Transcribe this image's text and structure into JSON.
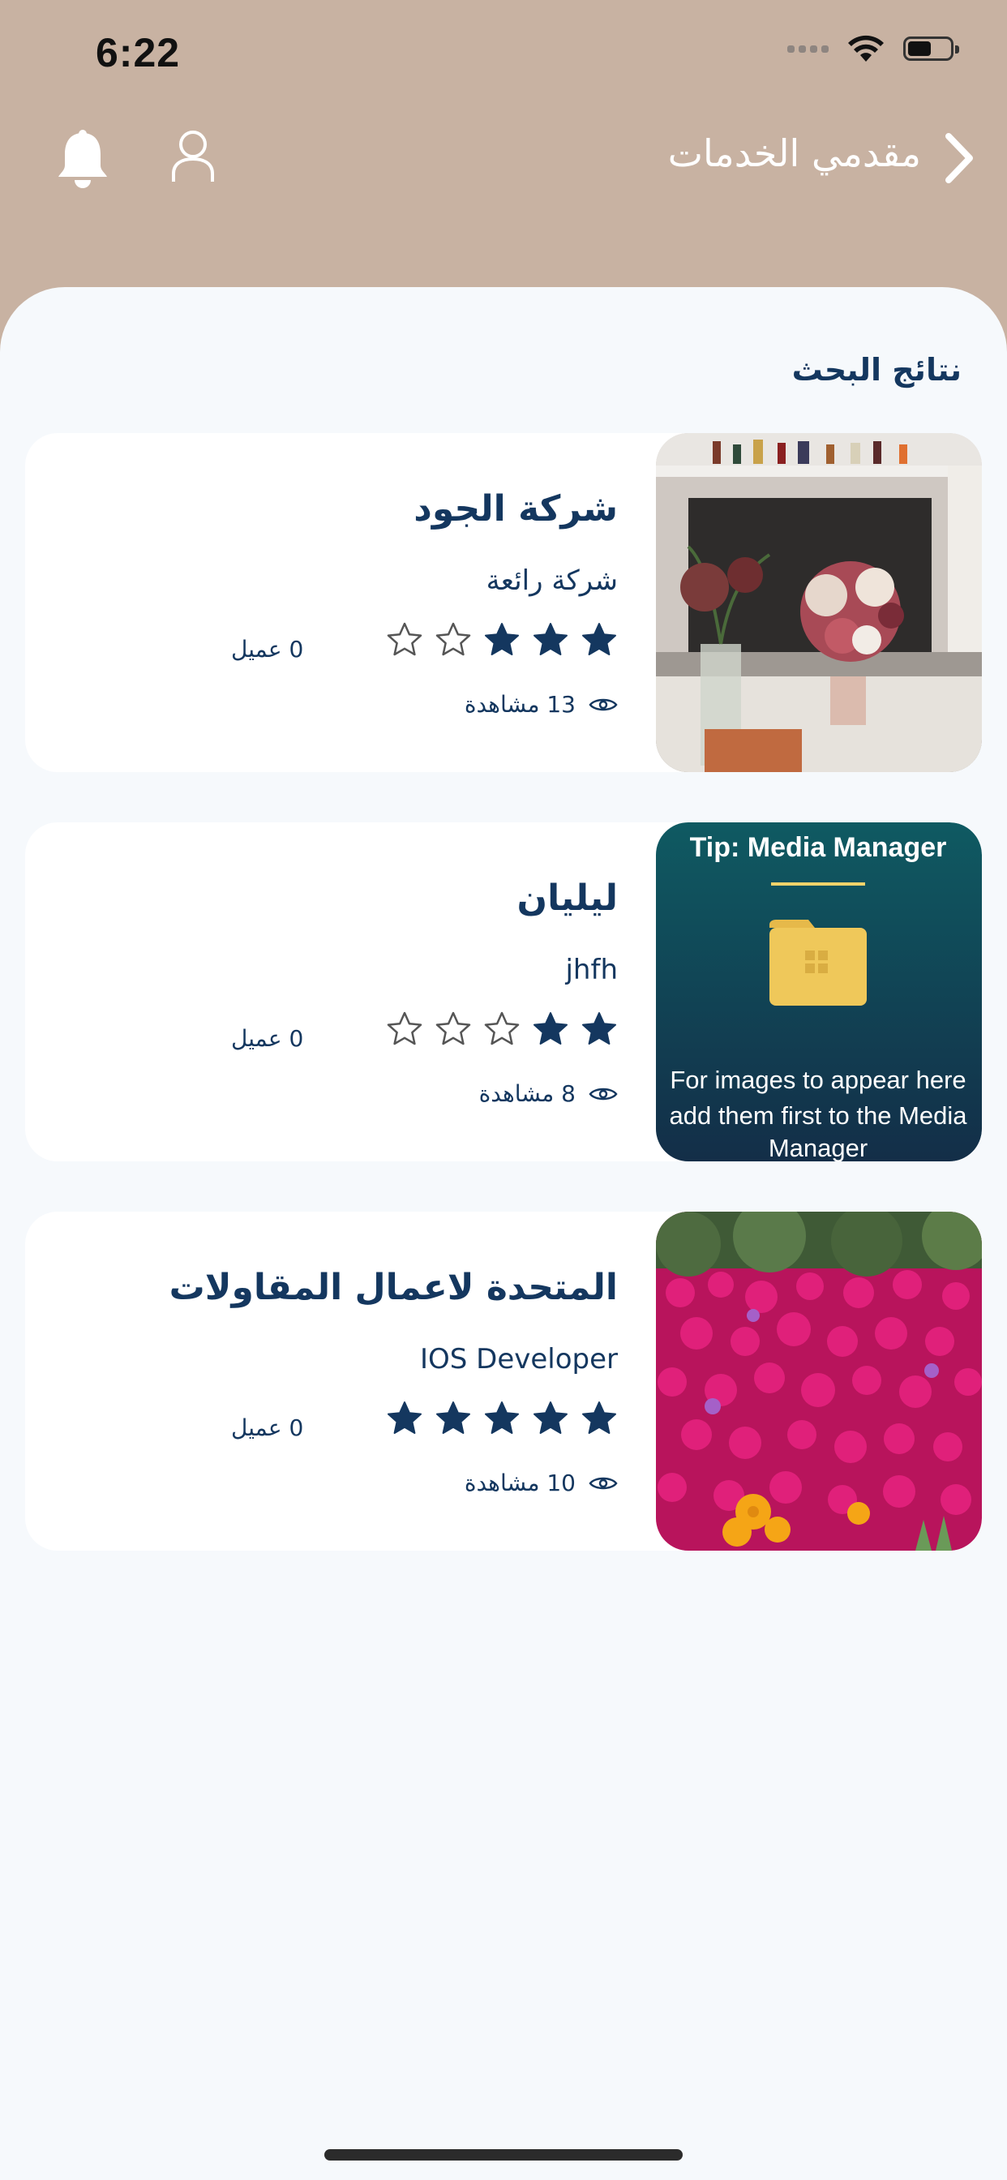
{
  "status": {
    "time": "6:22"
  },
  "header": {
    "title": "مقدمي الخدمات"
  },
  "section_title": "نتائج البحث",
  "results": [
    {
      "name": "شركة الجود",
      "subtitle": "شركة رائعة",
      "rating": 3,
      "clients": "0 عميل",
      "views": "13 مشاهدة"
    },
    {
      "name": "ليليان",
      "subtitle": "jhfh",
      "rating": 2,
      "clients": "0 عميل",
      "views": "8 مشاهدة",
      "image_text": {
        "heading": "Tip: Media Manager",
        "line1": "For images to appear here",
        "line2": "add them first to the Media",
        "line3": "Manager"
      }
    },
    {
      "name": "المتحدة لاعمال المقاولات",
      "subtitle": "IOS Developer",
      "rating": 5,
      "clients": "0 عميل",
      "views": "10 مشاهدة"
    }
  ],
  "colors": {
    "header_bg": "#c8b2a2",
    "accent": "#14375f",
    "sheet_bg": "#f6f9fc"
  }
}
